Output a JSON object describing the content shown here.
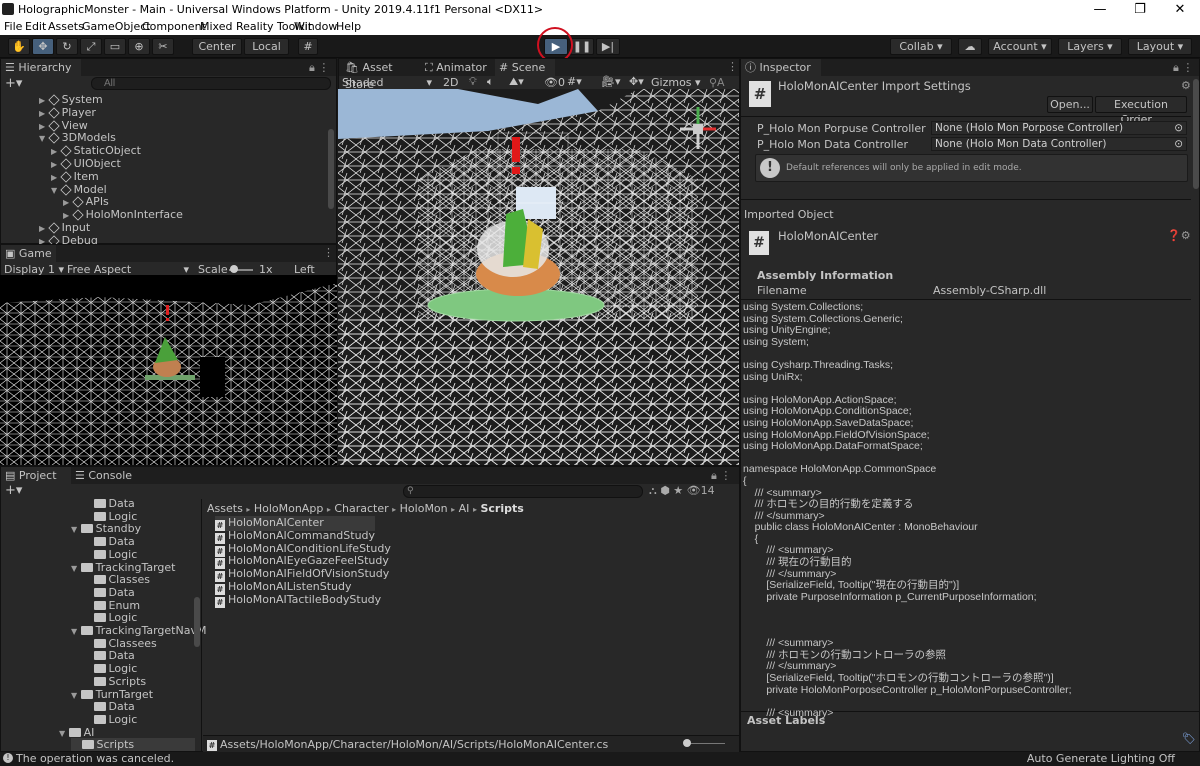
{
  "window": {
    "title": "HolographicMonster - Main - Universal Windows Platform - Unity 2019.4.11f1 Personal <DX11>",
    "min": "—",
    "max": "❐",
    "close": "✕"
  },
  "menu": [
    "File",
    "Edit",
    "Assets",
    "GameObject",
    "Component",
    "Mixed Reality Toolkit",
    "Window",
    "Help"
  ],
  "toolbar": {
    "center": "Center",
    "local": "Local",
    "collab": "Collab",
    "account": "Account",
    "layers": "Layers",
    "layout": "Layout"
  },
  "hierarchy": {
    "tab": "Hierarchy",
    "search_placeholder": "All",
    "items": [
      {
        "label": "System",
        "indent": 1,
        "icon": "cube"
      },
      {
        "label": "Player",
        "indent": 1,
        "icon": "cube"
      },
      {
        "label": "View",
        "indent": 1,
        "icon": "cube"
      },
      {
        "label": "3DModels",
        "indent": 1,
        "icon": "cube",
        "open": true
      },
      {
        "label": "StaticObject",
        "indent": 2,
        "icon": "cube"
      },
      {
        "label": "UIObject",
        "indent": 2,
        "icon": "cube"
      },
      {
        "label": "Item",
        "indent": 2,
        "icon": "cube"
      },
      {
        "label": "Model",
        "indent": 2,
        "icon": "cube",
        "open": true
      },
      {
        "label": "APIs",
        "indent": 3,
        "icon": "cube"
      },
      {
        "label": "HoloMonInterface",
        "indent": 3,
        "icon": "cube"
      },
      {
        "label": "Input",
        "indent": 1,
        "icon": "cube"
      },
      {
        "label": "Debug",
        "indent": 1,
        "icon": "cube"
      }
    ]
  },
  "game": {
    "tab": "Game",
    "display": "Display 1",
    "aspect": "Free Aspect",
    "scale_label": "Scale",
    "scale_value": "1x",
    "left_eye": "Left Eye"
  },
  "scene": {
    "tabs": [
      "Asset Store",
      "Animator",
      "Scene"
    ],
    "shading": "Shaded",
    "mode2d": "2D",
    "gizmos": "Gizmos",
    "hidden_count": "0"
  },
  "project": {
    "tabs": [
      "Project",
      "Console"
    ],
    "hidden_count": "14",
    "breadcrumb": [
      "Assets",
      "HoloMonApp",
      "Character",
      "HoloMon",
      "AI",
      "Scripts"
    ],
    "tree": [
      {
        "label": "Data",
        "indent": 3
      },
      {
        "label": "Logic",
        "indent": 3
      },
      {
        "label": "Standby",
        "indent": 2,
        "open": true
      },
      {
        "label": "Data",
        "indent": 3
      },
      {
        "label": "Logic",
        "indent": 3
      },
      {
        "label": "TrackingTarget",
        "indent": 2,
        "open": true
      },
      {
        "label": "Classes",
        "indent": 3
      },
      {
        "label": "Data",
        "indent": 3
      },
      {
        "label": "Enum",
        "indent": 3
      },
      {
        "label": "Logic",
        "indent": 3
      },
      {
        "label": "TrackingTargetNavM",
        "indent": 2,
        "open": true
      },
      {
        "label": "Classees",
        "indent": 3
      },
      {
        "label": "Data",
        "indent": 3
      },
      {
        "label": "Logic",
        "indent": 3
      },
      {
        "label": "Scripts",
        "indent": 3
      },
      {
        "label": "TurnTarget",
        "indent": 2,
        "open": true
      },
      {
        "label": "Data",
        "indent": 3
      },
      {
        "label": "Logic",
        "indent": 3
      },
      {
        "label": "AI",
        "indent": 1,
        "open": true
      },
      {
        "label": "Scripts",
        "indent": 2,
        "selected": true
      }
    ],
    "files": [
      "HoloMonAICenter",
      "HoloMonAICommandStudy",
      "HoloMonAIConditionLifeStudy",
      "HoloMonAIEyeGazeFeelStudy",
      "HoloMonAIFieldOfVisionStudy",
      "HoloMonAIListenStudy",
      "HoloMonAITactileBodyStudy"
    ],
    "path": "Assets/HoloMonApp/Character/HoloMon/AI/Scripts/HoloMonAICenter.cs"
  },
  "inspector": {
    "tab": "Inspector",
    "title": "HoloMonAICenter Import Settings",
    "open_btn": "Open...",
    "exec_btn": "Execution Order...",
    "fields": [
      {
        "label": "P_Holo Mon Porpuse Controller",
        "value": "None (Holo Mon Porpose Controller)"
      },
      {
        "label": "P_Holo Mon Data Controller",
        "value": "None (Holo Mon Data Controller)"
      }
    ],
    "notice": "Default references will only be applied in edit mode.",
    "imported_object": "Imported Object",
    "imported_name": "HoloMonAICenter",
    "assembly_info": "Assembly Information",
    "filename_label": "Filename",
    "filename_value": "Assembly-CSharp.dll",
    "code": "using System.Collections;\nusing System.Collections.Generic;\nusing UnityEngine;\nusing System;\n\nusing Cysharp.Threading.Tasks;\nusing UniRx;\n\nusing HoloMonApp.ActionSpace;\nusing HoloMonApp.ConditionSpace;\nusing HoloMonApp.SaveDataSpace;\nusing HoloMonApp.FieldOfVisionSpace;\nusing HoloMonApp.DataFormatSpace;\n\nnamespace HoloMonApp.CommonSpace\n{\n    /// <summary>\n    /// ホロモンの目的行動を定義する\n    /// </summary>\n    public class HoloMonAICenter : MonoBehaviour\n    {\n        /// <summary>\n        /// 現在の行動目的\n        /// </summary>\n        [SerializeField, Tooltip(\"現在の行動目的\")]\n        private PurposeInformation p_CurrentPurposeInformation;\n\n\n\n        /// <summary>\n        /// ホロモンの行動コントローラの参照\n        /// </summary>\n        [SerializeField, Tooltip(\"ホロモンの行動コントローラの参照\")]\n        private HoloMonPorposeController p_HoloMonPorpuseController;\n\n        /// <summary>",
    "asset_labels": "Asset Labels"
  },
  "status": {
    "message": "The operation was canceled.",
    "lighting": "Auto Generate Lighting Off"
  }
}
